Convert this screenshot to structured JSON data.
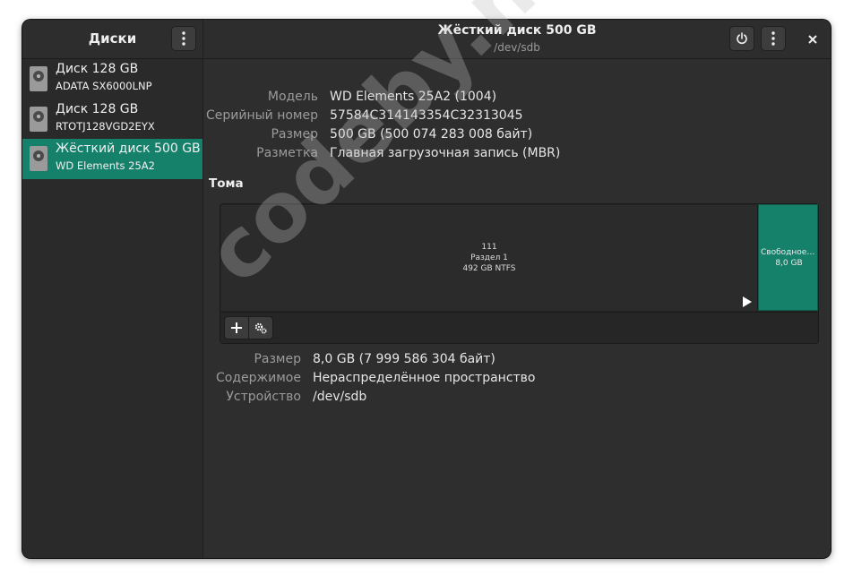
{
  "sidebar": {
    "title": "Диски",
    "disks": [
      {
        "name": "Диск 128 GB",
        "model": "ADATA SX6000LNP",
        "selected": false
      },
      {
        "name": "Диск 128 GB",
        "model": "RTOTJ128VGD2EYX",
        "selected": false
      },
      {
        "name": "Жёсткий диск 500 GB",
        "model": "WD Elements 25A2",
        "selected": true
      }
    ]
  },
  "header": {
    "title": "Жёсткий диск 500 GB",
    "subtitle": "/dev/sdb"
  },
  "drive_properties": [
    {
      "label": "Модель",
      "value": "WD Elements 25A2 (1004)"
    },
    {
      "label": "Серийный номер",
      "value": "57584C314143354C32313045"
    },
    {
      "label": "Размер",
      "value": "500 GB (500 074 283 008 байт)"
    },
    {
      "label": "Разметка",
      "value": "Главная загрузочная запись (MBR)"
    }
  ],
  "volumes": {
    "title": "Тома",
    "partition": {
      "line1": "111",
      "line2": "Раздел 1",
      "line3": "492 GB NTFS"
    },
    "free_space": {
      "line1": "Свободное пространство",
      "line2": "8,0 GB"
    }
  },
  "volume_properties": [
    {
      "label": "Размер",
      "value": "8,0 GB (7 999 586 304 байт)"
    },
    {
      "label": "Содержимое",
      "value": "Нераспределённое пространство"
    },
    {
      "label": "Устройство",
      "value": "/dev/sdb"
    }
  ],
  "watermark": "codeby.net",
  "colors": {
    "accent": "#15816b",
    "background": "#2e2e2e",
    "sidebar": "#2a2a2a"
  }
}
